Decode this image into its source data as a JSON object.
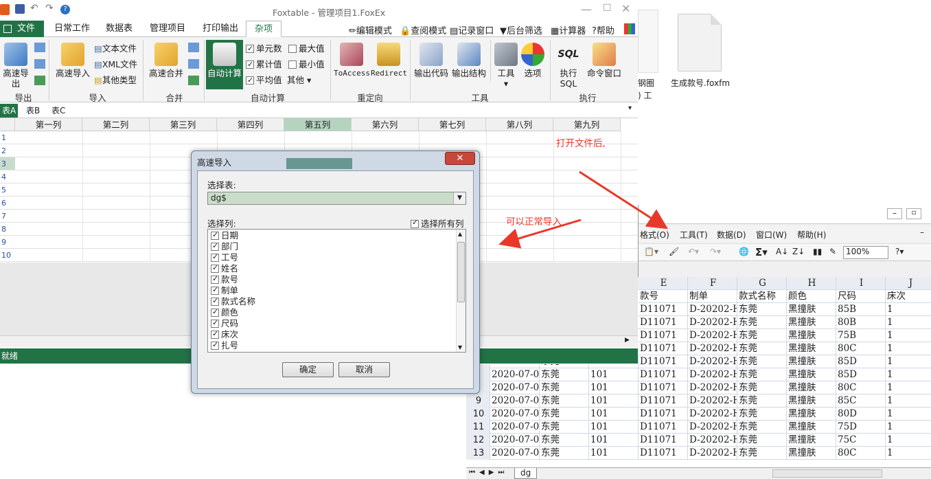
{
  "explorer": {
    "file_label": "生成款号.foxfm",
    "partial_label_1": "钢圈",
    "partial_label_2": ") 工"
  },
  "foxtable": {
    "title": "Foxtable - 管理项目1.FoxEx",
    "tabs": [
      "文件",
      "日常工作",
      "数据表",
      "管理项目",
      "打印输出",
      "杂项"
    ],
    "active_tab": "杂项",
    "quick_tools": [
      "编辑模式",
      "查阅模式",
      "记录窗口",
      "后台筛选",
      "计算器",
      "帮助"
    ],
    "groups": {
      "export": "导出",
      "import": "导入",
      "merge": "合并",
      "autocalc": "自动计算",
      "redirect": "重定向",
      "tools": "工具",
      "execute": "执行"
    },
    "buttons": {
      "fast_export": "高速导出",
      "fast_import": "高速导入",
      "text_file": "文本文件",
      "xml_file": "XML文件",
      "other_types": "其他类型",
      "fast_merge": "高速合并",
      "auto_calc": "自动计算",
      "unit_value": "单元数",
      "max_value": "最大值",
      "cumulative": "累计值",
      "min_value": "最小值",
      "average": "平均值",
      "other": "其他",
      "to_access": "ToAccess",
      "redirect": "Redirect",
      "output_code": "输出代码",
      "output_structure": "输出结构",
      "tools": "工具",
      "options": "选项",
      "exec_sql": "执行SQL",
      "cmd_window": "命令窗口"
    },
    "sheet_tabs": [
      "表A",
      "表B",
      "表C"
    ],
    "columns": [
      "第一列",
      "第二列",
      "第三列",
      "第四列",
      "第五列",
      "第六列",
      "第七列",
      "第八列",
      "第九列"
    ],
    "rows": [
      "1",
      "2",
      "3",
      "4",
      "5",
      "6",
      "7",
      "8",
      "9",
      "10"
    ],
    "status": "就绪"
  },
  "dialog": {
    "title": "高速导入",
    "table_label": "选择表:",
    "table_value": "dg$",
    "columns_label": "选择列:",
    "select_all": "选择所有列",
    "column_items": [
      "日期",
      "部门",
      "工号",
      "姓名",
      "款号",
      "制单",
      "款式名称",
      "颜色",
      "尺码",
      "床次",
      "扎号"
    ],
    "ok": "确定",
    "cancel": "取消"
  },
  "annotations": {
    "note1": "打开文件后,",
    "note2": "可以正常导入"
  },
  "excel": {
    "menus": [
      "格式(O)",
      "工具(T)",
      "数据(D)",
      "窗口(W)",
      "帮助(H)"
    ],
    "zoom": "100%",
    "col_headers": [
      "E",
      "F",
      "G",
      "H",
      "I",
      "J"
    ],
    "field_headers": [
      "款号",
      "制单",
      "款式名称",
      "颜色",
      "尺码",
      "床次"
    ],
    "top_rows": [
      [
        "D11071",
        "D-20202-H",
        "东莞",
        "黑撞肤",
        "85B",
        "1"
      ],
      [
        "D11071",
        "D-20202-H",
        "东莞",
        "黑撞肤",
        "80B",
        "1"
      ],
      [
        "D11071",
        "D-20202-H",
        "东莞",
        "黑撞肤",
        "75B",
        "1"
      ],
      [
        "D11071",
        "D-20202-H",
        "东莞",
        "黑撞肤",
        "80C",
        "1"
      ]
    ],
    "bottom_rows": [
      {
        "n": "",
        "date": "2020-07-0",
        "dept": "东莞",
        "code": "101",
        "style": "D11071",
        "order": "D-20202-H",
        "city": "东莞",
        "color": "黑撞肤",
        "size": "85D",
        "bed": "1"
      },
      {
        "n": "",
        "date": "2020-07-0",
        "dept": "东莞",
        "code": "101",
        "style": "D11071",
        "order": "D-20202-H",
        "city": "东莞",
        "color": "黑撞肤",
        "size": "85D",
        "bed": "1"
      },
      {
        "n": "",
        "date": "2020-07-0",
        "dept": "东莞",
        "code": "101",
        "style": "D11071",
        "order": "D-20202-H",
        "city": "东莞",
        "color": "黑撞肤",
        "size": "80C",
        "bed": "1"
      },
      {
        "n": "9",
        "date": "2020-07-0",
        "dept": "东莞",
        "code": "101",
        "style": "D11071",
        "order": "D-20202-H",
        "city": "东莞",
        "color": "黑撞肤",
        "size": "85C",
        "bed": "1"
      },
      {
        "n": "10",
        "date": "2020-07-0",
        "dept": "东莞",
        "code": "101",
        "style": "D11071",
        "order": "D-20202-H",
        "city": "东莞",
        "color": "黑撞肤",
        "size": "80D",
        "bed": "1"
      },
      {
        "n": "11",
        "date": "2020-07-0",
        "dept": "东莞",
        "code": "101",
        "style": "D11071",
        "order": "D-20202-H",
        "city": "东莞",
        "color": "黑撞肤",
        "size": "75D",
        "bed": "1"
      },
      {
        "n": "12",
        "date": "2020-07-0",
        "dept": "东莞",
        "code": "101",
        "style": "D11071",
        "order": "D-20202-H",
        "city": "东莞",
        "color": "黑撞肤",
        "size": "75C",
        "bed": "1"
      },
      {
        "n": "13",
        "date": "2020-07-0",
        "dept": "东莞",
        "code": "101",
        "style": "D11071",
        "order": "D-20202-H",
        "city": "东莞",
        "color": "黑撞肤",
        "size": "80C",
        "bed": "1"
      }
    ],
    "sheet_tab": "dg"
  }
}
